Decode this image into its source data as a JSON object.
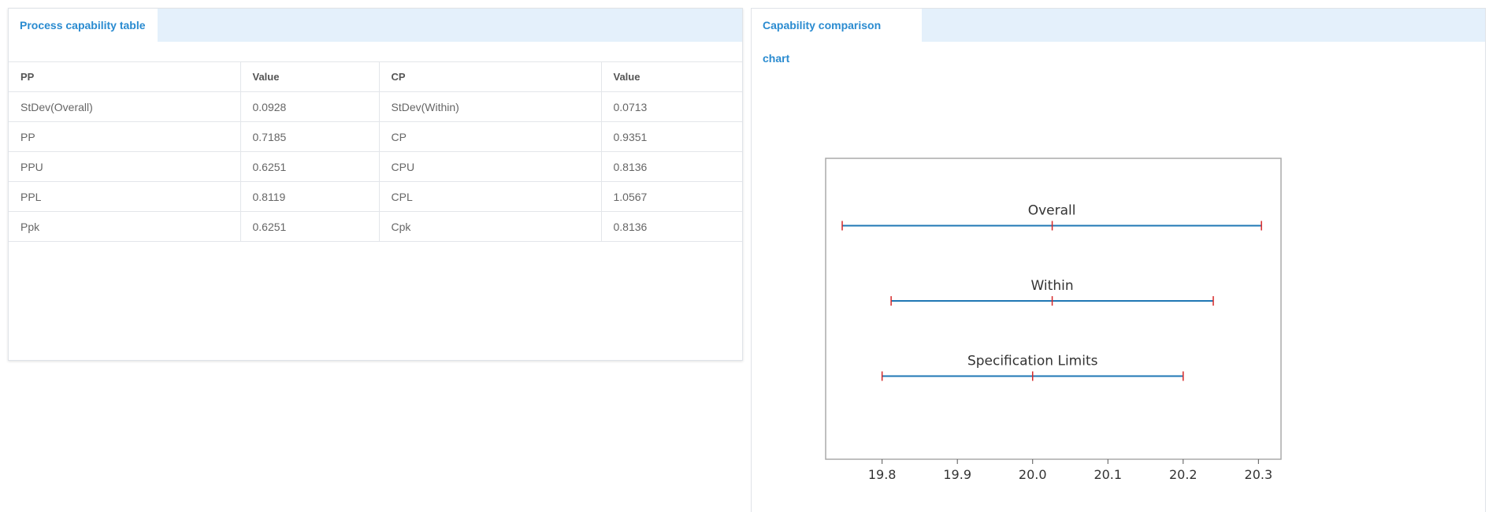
{
  "left_panel": {
    "tab_label": "Process capability table",
    "table": {
      "headers": [
        "PP",
        "Value",
        "CP",
        "Value"
      ],
      "rows": [
        [
          "StDev(Overall)",
          "0.0928",
          "StDev(Within)",
          "0.0713"
        ],
        [
          "PP",
          "0.7185",
          "CP",
          "0.9351"
        ],
        [
          "PPU",
          "0.6251",
          "CPU",
          "0.8136"
        ],
        [
          "PPL",
          "0.8119",
          "CPL",
          "1.0567"
        ],
        [
          "Ppk",
          "0.6251",
          "Cpk",
          "0.8136"
        ]
      ]
    }
  },
  "right_panel": {
    "tab_label": "Capability comparison chart"
  },
  "chart_data": {
    "type": "interval",
    "xlim": [
      19.725,
      20.33
    ],
    "x_ticks": [
      "19.8",
      "19.9",
      "20.0",
      "20.1",
      "20.2",
      "20.3"
    ],
    "intervals": [
      {
        "label": "Overall",
        "low": 19.747,
        "mid": 20.026,
        "high": 20.304
      },
      {
        "label": "Within",
        "low": 19.812,
        "mid": 20.026,
        "high": 20.24
      },
      {
        "label": "Specification Limits",
        "low": 19.8,
        "mid": 20.0,
        "high": 20.2
      }
    ],
    "colors": {
      "line": "#1f77b4",
      "ticks": "#d62728",
      "frame": "#aaaaaa"
    }
  }
}
